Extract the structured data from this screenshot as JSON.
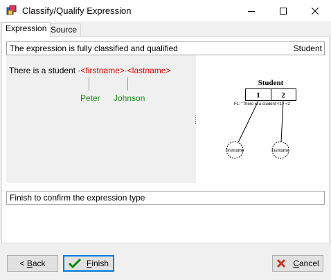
{
  "window": {
    "title": "Classify/Qualify Expression"
  },
  "tabs": [
    {
      "label": "Expression"
    },
    {
      "label": "Source"
    }
  ],
  "status": {
    "message": "The expression is fully classified and qualified",
    "type": "Student"
  },
  "expression": {
    "plain": "There is a student",
    "variables": [
      "<firstname>",
      "<lastname>"
    ],
    "values": [
      "Peter",
      "Johnson"
    ]
  },
  "diagram": {
    "type_name": "Student",
    "slots": [
      "1",
      "2"
    ],
    "caption": "F1: \"There is a student <1> <2",
    "roles": [
      "firstname",
      "lastname"
    ]
  },
  "footer": {
    "message": "Finish to confirm the expression type"
  },
  "buttons": {
    "back": {
      "prefix": "< ",
      "mnemonic": "B",
      "rest": "ack"
    },
    "finish": {
      "mnemonic": "F",
      "rest": "inish"
    },
    "cancel": {
      "mnemonic": "C",
      "rest": "ancel"
    }
  }
}
